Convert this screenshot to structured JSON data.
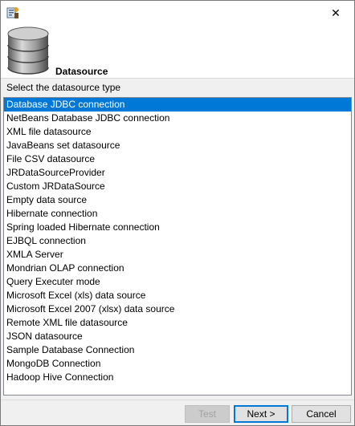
{
  "dialog": {
    "banner_title": "Datasource",
    "prompt": "Select the datasource type",
    "close_glyph": "✕",
    "icons": {
      "app": "jasper-app-icon",
      "banner": "database-icon",
      "close": "close-icon"
    },
    "colors": {
      "selection": "#0078d7",
      "background": "#f0f0f0"
    }
  },
  "datasources": [
    "Database JDBC connection",
    "NetBeans Database JDBC connection",
    "XML file datasource",
    "JavaBeans set datasource",
    "File CSV datasource",
    "JRDataSourceProvider",
    "Custom JRDataSource",
    "Empty data source",
    "Hibernate connection",
    "Spring loaded Hibernate connection",
    "EJBQL connection",
    "XMLA Server",
    "Mondrian OLAP connection",
    "Query Executer mode",
    "Microsoft Excel (xls) data source",
    "Microsoft Excel 2007 (xlsx) data source",
    "Remote XML file datasource",
    "JSON datasource",
    "Sample Database Connection",
    "MongoDB Connection",
    "Hadoop Hive Connection"
  ],
  "selected_index": 0,
  "buttons": {
    "test": "Test",
    "next": "Next >",
    "cancel": "Cancel"
  }
}
